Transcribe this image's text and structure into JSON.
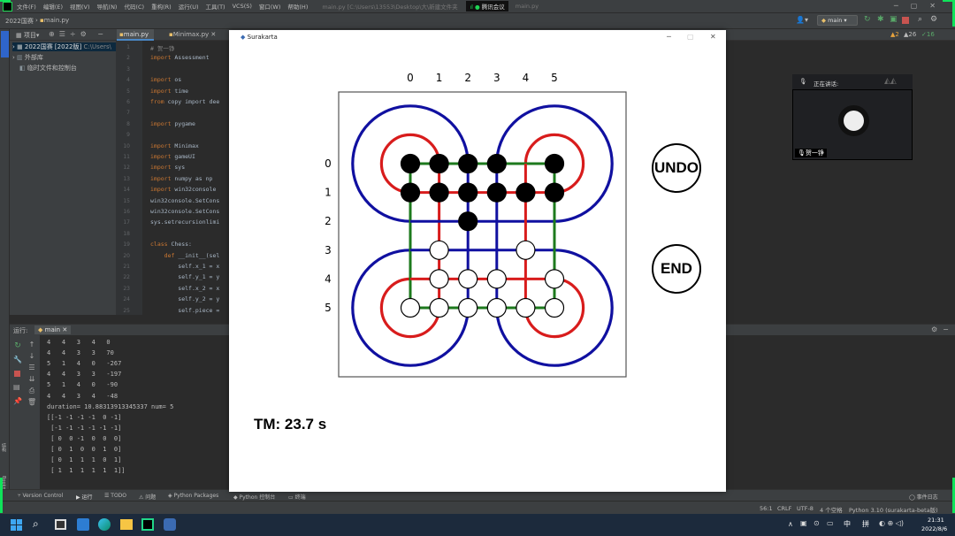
{
  "ide": {
    "menu": [
      "文件(F)",
      "编辑(E)",
      "视图(V)",
      "导航(N)",
      "代码(C)",
      "重构(R)",
      "运行(U)",
      "工具(T)",
      "VCS(S)",
      "窗口(W)",
      "帮助(H)"
    ],
    "window_title": "main.py [C:\\Users\\13553\\Desktop\\大\\新建文件夹",
    "meeting_app": "腾讯会议",
    "window_title_right": "main.py",
    "breadcrumb_project": "2022国赛",
    "breadcrumb_file": "main.py",
    "run_config": "main",
    "project_panel": {
      "label": "项目",
      "tree": [
        "2022国赛 [2022版]",
        "外部库",
        "临时文件和控制台"
      ],
      "root_path": "C:\\Users\\"
    },
    "tabs": [
      "main.py",
      "Minimax.py"
    ],
    "warnings": "▲2",
    "weak_warnings": "▲26",
    "typos": "✓16",
    "line_numbers": [
      "1",
      "2",
      "3",
      "4",
      "5",
      "6",
      "7",
      "8",
      "9",
      "10",
      "11",
      "12",
      "13",
      "14",
      "15",
      "16",
      "17",
      "18",
      "19",
      "20",
      "21",
      "22",
      "23",
      "24",
      "25"
    ],
    "code_lines": [
      {
        "kw": "",
        "text": "# 贺一铮"
      },
      {
        "kw": "import",
        "text": " Assessment"
      },
      {
        "kw": "",
        "text": ""
      },
      {
        "kw": "import",
        "text": " os"
      },
      {
        "kw": "import",
        "text": " time"
      },
      {
        "kw": "from",
        "text": " copy import dee"
      },
      {
        "kw": "",
        "text": ""
      },
      {
        "kw": "import",
        "text": " pygame"
      },
      {
        "kw": "",
        "text": ""
      },
      {
        "kw": "import",
        "text": " Minimax"
      },
      {
        "kw": "import",
        "text": " gameUI"
      },
      {
        "kw": "import",
        "text": " sys"
      },
      {
        "kw": "import",
        "text": " numpy as np"
      },
      {
        "kw": "import",
        "text": " win32console"
      },
      {
        "kw": "",
        "text": "win32console.SetCons"
      },
      {
        "kw": "",
        "text": "win32console.SetCons"
      },
      {
        "kw": "",
        "text": "sys.setrecursionlimi"
      },
      {
        "kw": "",
        "text": ""
      },
      {
        "kw": "class",
        "text": " Chess:"
      },
      {
        "kw": "    def",
        "text": " __init__(sel"
      },
      {
        "kw": "",
        "text": "        self.x_1 = x"
      },
      {
        "kw": "",
        "text": "        self.y_1 = y"
      },
      {
        "kw": "",
        "text": "        self.x_2 = x"
      },
      {
        "kw": "",
        "text": "        self.y_2 = y"
      },
      {
        "kw": "",
        "text": "        self.piece ="
      }
    ],
    "run_label": "运行:",
    "run_tab": "main",
    "console_lines": [
      "4   4   3   4   0",
      "4   4   3   3   70",
      "5   1   4   0   -267",
      "4   4   3   3   -197",
      "5   1   4   0   -90",
      "4   4   3   4   -48",
      "duration= 10.88313913345337 num= 5",
      "[[-1 -1 -1 -1  0 -1]",
      " [-1 -1 -1 -1 -1 -1]",
      " [ 0  0 -1  0  0  0]",
      " [ 0  1  0  0  1  0]",
      " [ 0  1  1  1  0  1]",
      " [ 1  1  1  1  1  1]]"
    ],
    "bottom_tabs": [
      "Version Control",
      "运行",
      "TODO",
      "问题",
      "Python Packages",
      "Python 控制台",
      "终端"
    ],
    "event_log": "事件日志",
    "status": [
      "56:1",
      "CRLF",
      "UTF-8",
      "4 个空格",
      "Python 3.10 (surakarta-beta版)"
    ],
    "side_labels": [
      "结构",
      "Bookmarks"
    ]
  },
  "game": {
    "window_title": "Surakarta",
    "col_labels": [
      "0",
      "1",
      "2",
      "3",
      "4",
      "5"
    ],
    "row_labels": [
      "0",
      "1",
      "2",
      "3",
      "4",
      "5"
    ],
    "undo_label": "UNDO",
    "end_label": "END",
    "timer_text": "TM: 23.7 s",
    "colors": {
      "outer_loop": "#1010a0",
      "inner_loop": "#d81c1c",
      "board_line": "#1d7a1d"
    },
    "board": [
      [
        -1,
        -1,
        -1,
        -1,
        0,
        -1
      ],
      [
        -1,
        -1,
        -1,
        -1,
        -1,
        -1
      ],
      [
        0,
        0,
        -1,
        0,
        0,
        0
      ],
      [
        0,
        1,
        0,
        0,
        1,
        0
      ],
      [
        0,
        1,
        1,
        1,
        0,
        1
      ],
      [
        1,
        1,
        1,
        1,
        1,
        1
      ]
    ]
  },
  "meeting": {
    "speaking_label": "正在讲话:",
    "speaker_name": "贺一铮"
  },
  "taskbar": {
    "ime": [
      "中",
      "拼"
    ],
    "time": "21:31",
    "date": "2022/8/6"
  }
}
